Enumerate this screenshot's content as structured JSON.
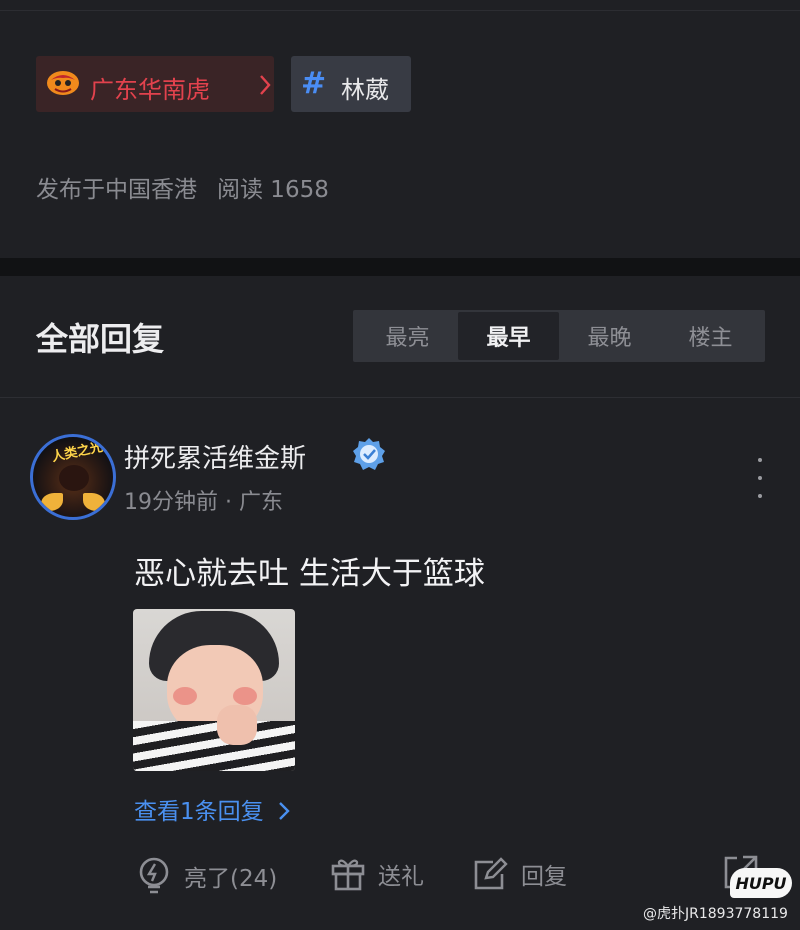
{
  "tags": {
    "team": {
      "label": "广东华南虎",
      "color": "#e2424d"
    },
    "topic": {
      "hash": "#",
      "label": "林葳",
      "hash_color": "#4a8df4"
    }
  },
  "post_meta": {
    "location": "发布于中国香港",
    "reads": "阅读 1658"
  },
  "replies": {
    "title": "全部回复",
    "sort_tabs": [
      {
        "label": "最亮",
        "active": false
      },
      {
        "label": "最早",
        "active": true
      },
      {
        "label": "最晚",
        "active": false
      },
      {
        "label": "楼主",
        "active": false
      }
    ]
  },
  "comment": {
    "avatar_text": "人类之光",
    "username": "拼死累活维金斯",
    "time": "19分钟前",
    "region": "广东",
    "text": "恶心就去吐 生活大于篮球",
    "view_replies": "查看1条回复",
    "actions": {
      "like": "亮了(24)",
      "gift": "送礼",
      "reply": "回复"
    }
  },
  "watermark": {
    "logo": "HUPU",
    "credit": "@虎扑JR1893778119"
  },
  "colors": {
    "background": "#1f2024",
    "link": "#4a90f0",
    "muted": "#8a8b91"
  }
}
